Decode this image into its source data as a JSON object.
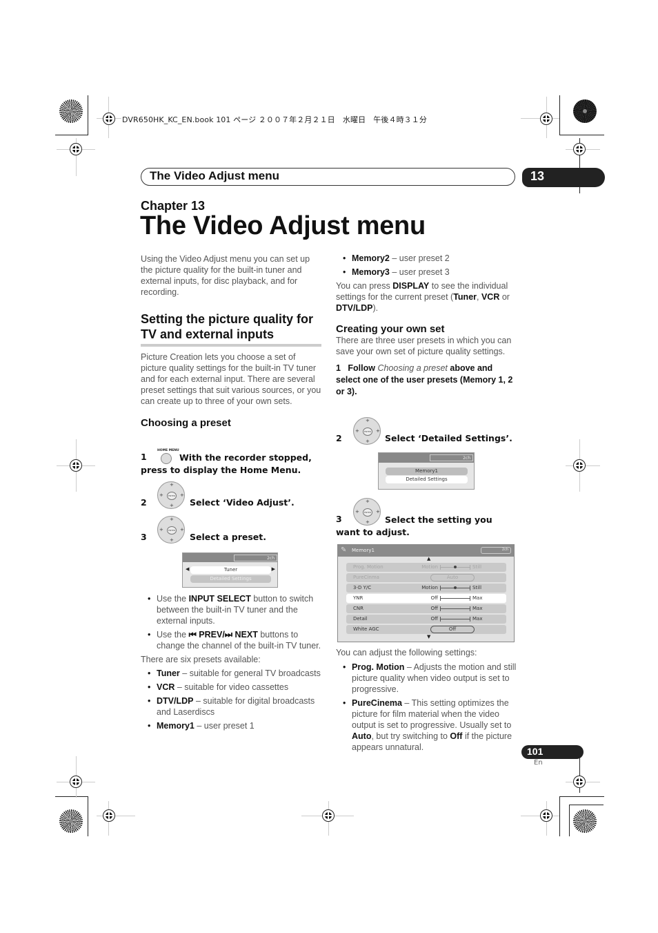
{
  "file_header": "DVR650HK_KC_EN.book  101 ページ  ２００７年２月２１日　水曜日　午後４時３１分",
  "running_header": {
    "title": "The Video Adjust menu",
    "chapter_number": "13"
  },
  "chapter": {
    "label": "Chapter 13",
    "title": "The Video Adjust menu"
  },
  "left_column": {
    "intro": "Using the Video Adjust menu you can set up the picture quality for the built-in tuner and external inputs, for disc playback, and for recording.",
    "section_heading": "Setting the picture quality for TV and external inputs",
    "section_body": "Picture Creation lets you choose a set of picture quality settings for the built-in TV tuner and for each external input. There are several preset settings that suit various sources, or you can create up to three of your own sets.",
    "subheading": "Choosing a preset",
    "steps": [
      {
        "number": "1",
        "button_label": "HOME MENU",
        "text": "With the recorder stopped, press to display the Home Menu."
      },
      {
        "number": "2",
        "text": "Select ‘Video Adjust’."
      },
      {
        "number": "3",
        "text": "Select a preset."
      }
    ],
    "screen1": {
      "channel": "2ch",
      "selected": "Tuner",
      "option": "Detailed Settings"
    },
    "tips": [
      {
        "pre": "Use the ",
        "bold": "INPUT SELECT",
        "post": " button to switch between the built-in TV tuner and the external inputs."
      },
      {
        "pre": "Use the ",
        "bold": "⏮ PREV/⏭ NEXT",
        "post": " buttons to change the channel of the built-in TV tuner."
      }
    ],
    "presets_intro": "There are six presets available:",
    "presets": [
      {
        "name": "Tuner",
        "desc": " – suitable for general TV broadcasts"
      },
      {
        "name": "VCR",
        "desc": " – suitable for video cassettes"
      },
      {
        "name": "DTV/LDP",
        "desc": " – suitable for digital broadcasts and Laserdiscs"
      },
      {
        "name": "Memory1",
        "desc": " – user preset 1"
      }
    ]
  },
  "right_column": {
    "presets_cont": [
      {
        "name": "Memory2",
        "desc": " – user preset 2"
      },
      {
        "name": "Memory3",
        "desc": " – user preset 3"
      }
    ],
    "display_note": {
      "t1": "You can press ",
      "b1": "DISPLAY",
      "t2": " to see the individual settings for the current preset (",
      "b2": "Tuner",
      "t3": ", ",
      "b3": "VCR",
      "t4": " or ",
      "b4": "DTV/LDP",
      "t5": ")."
    },
    "subheading": "Creating your own set",
    "subbody": "There are three user presets in which you can save your own set of picture quality settings.",
    "step1": {
      "number": "1",
      "pre": "Follow ",
      "italic": "Choosing a preset",
      "post": " above and select one of the user presets (Memory 1, 2 or 3)."
    },
    "step2": {
      "number": "2",
      "text": "Select ‘Detailed Settings’."
    },
    "screen2": {
      "channel": "2ch",
      "selected": "Memory1",
      "option": "Detailed Settings"
    },
    "step3": {
      "number": "3",
      "text": "Select the setting you want to adjust."
    },
    "osd": {
      "title": "Memory1",
      "channel": "2ch",
      "rows": [
        {
          "name": "Prog. Motion",
          "left": "Motion",
          "right": "Still",
          "type": "slider",
          "value": 0.5,
          "dim": true
        },
        {
          "name": "PureCinma",
          "value_text": "Auto",
          "type": "oval",
          "dim": true
        },
        {
          "name": "3-D Y/C",
          "left": "Motion",
          "right": "Still",
          "type": "slider",
          "value": 0.5,
          "dim": false
        },
        {
          "name": "YNR",
          "left": "Off",
          "right": "Max",
          "type": "slider",
          "value": null,
          "dim": false,
          "selected": true
        },
        {
          "name": "CNR",
          "left": "Off",
          "right": "Max",
          "type": "slider",
          "value": null,
          "dim": false
        },
        {
          "name": "Detail",
          "left": "Off",
          "right": "Max",
          "type": "slider",
          "value": null,
          "dim": false
        },
        {
          "name": "White AGC",
          "value_text": "Off",
          "type": "oval",
          "dim": false
        }
      ]
    },
    "adjust_intro": "You can adjust the following settings:",
    "settings": [
      {
        "name": "Prog. Motion",
        "desc": " – Adjusts the motion and still picture quality when video output is set to progressive."
      },
      {
        "name": "PureCinema",
        "desc": " – This setting optimizes the picture for film material when the video output is set to progressive. Usually set to ",
        "b1": "Auto",
        "mid": ", but try switching to ",
        "b2": "Off",
        "end": " if the picture appears unnatural."
      }
    ]
  },
  "footer": {
    "page_number": "101",
    "language": "En"
  }
}
